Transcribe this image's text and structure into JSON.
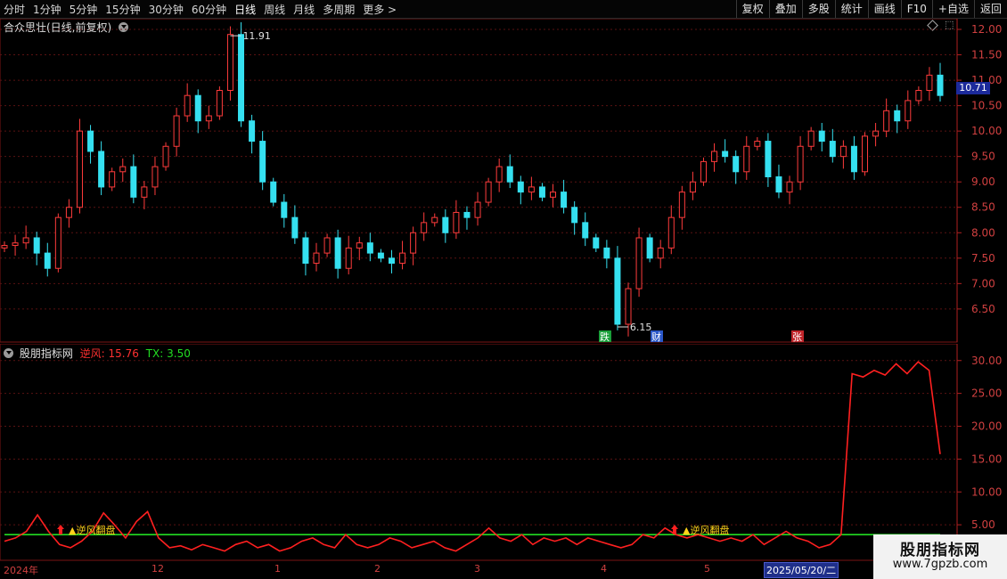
{
  "toolbar": {
    "periods": [
      "分时",
      "1分钟",
      "5分钟",
      "15分钟",
      "30分钟",
      "60分钟",
      "日线",
      "周线",
      "月线",
      "多周期"
    ],
    "active_period": "日线",
    "more_label": "更多",
    "buttons": [
      "复权",
      "叠加",
      "多股",
      "统计",
      "画线",
      "F10",
      "+自选",
      "返回"
    ]
  },
  "main_panel": {
    "title": "合众思壮(日线,前复权)",
    "y_ticks": [
      "12.00",
      "11.50",
      "11.00",
      "10.50",
      "10.00",
      "9.50",
      "9.00",
      "8.50",
      "8.00",
      "7.50",
      "7.00",
      "6.50"
    ],
    "current_price": "10.71",
    "high_label": "11.91",
    "low_label": "6.15",
    "badges": [
      {
        "text": "跌",
        "color": "#1aa03a"
      },
      {
        "text": "财",
        "color": "#2a57c8"
      },
      {
        "text": "张",
        "color": "#c0252a"
      }
    ]
  },
  "indicator_panel": {
    "title": "股朋指标网",
    "series1_label": "逆风: 15.76",
    "series2_label": "TX: 3.50",
    "y_ticks": [
      "30.00",
      "25.00",
      "20.00",
      "15.00",
      "10.00",
      "5.00"
    ],
    "signal_text": "▲逆风翻盘"
  },
  "date_axis": {
    "labels": [
      "2024年",
      "12",
      "1",
      "2",
      "3",
      "4",
      "5"
    ],
    "cursor_date": "2025/05/20/二"
  },
  "watermark": {
    "line1": "股朋指标网",
    "line2": "www.7gpzb.com"
  },
  "colors": {
    "up": "#ff3b3b",
    "down": "#35e0f0",
    "line_nifeng": "#ff2020",
    "line_tx": "#22dd22",
    "grid": "#5a1212"
  },
  "chart_data": [
    {
      "type": "line",
      "title": "合众思壮(日线,前复权)",
      "note_values": {
        "high": 11.91,
        "low": 6.15,
        "last": 10.71
      },
      "ylim": [
        6.2,
        12.0
      ],
      "x_labels": [
        "2024年",
        "12",
        "1",
        "2",
        "3",
        "4",
        "5"
      ],
      "series": [
        {
          "values": [
            7.75,
            7.8,
            7.9,
            7.6,
            7.3,
            8.3,
            8.5,
            10.0,
            9.6,
            8.9,
            9.2,
            9.3,
            8.7,
            8.9,
            9.3,
            9.7,
            10.3,
            10.7,
            10.2,
            10.3,
            10.8,
            11.9,
            10.2,
            9.8,
            9.0,
            8.6,
            8.3,
            7.9,
            7.4,
            7.6,
            7.9,
            7.3,
            7.7,
            7.8,
            7.6,
            7.5,
            7.4,
            7.6,
            8.0,
            8.2,
            8.3,
            8.0,
            8.4,
            8.3,
            8.6,
            9.0,
            9.3,
            9.0,
            8.8,
            8.9,
            8.7,
            8.8,
            8.5,
            8.2,
            7.9,
            7.7,
            7.5,
            6.2,
            6.9,
            7.9,
            7.5,
            7.7,
            8.3,
            8.8,
            9.0,
            9.4,
            9.6,
            9.5,
            9.2,
            9.7,
            9.8,
            9.1,
            8.8,
            9.0,
            9.7,
            10.0,
            9.8,
            9.5,
            9.7,
            9.2,
            9.9,
            10.0,
            10.4,
            10.2,
            10.6,
            10.8,
            11.1,
            10.7
          ]
        }
      ]
    },
    {
      "type": "line",
      "title": "股朋指标网",
      "ylim": [
        0,
        32
      ],
      "series": [
        {
          "name": "逆风",
          "values": [
            2.5,
            3.0,
            4.0,
            6.5,
            4.0,
            2.0,
            1.5,
            2.5,
            4.0,
            6.8,
            5.0,
            3.0,
            5.5,
            7.0,
            3.0,
            1.5,
            1.8,
            1.2,
            2.0,
            1.5,
            1.0,
            2.0,
            2.5,
            1.5,
            2.0,
            1.0,
            1.5,
            2.5,
            3.0,
            2.0,
            1.5,
            3.5,
            2.0,
            1.5,
            2.0,
            3.0,
            2.5,
            1.5,
            2.0,
            2.5,
            1.5,
            1.0,
            2.0,
            3.0,
            4.5,
            3.0,
            2.5,
            3.5,
            2.0,
            3.0,
            2.5,
            3.0,
            2.0,
            3.0,
            2.5,
            2.0,
            1.5,
            2.0,
            3.5,
            3.0,
            4.5,
            3.5,
            3.0,
            3.5,
            3.0,
            2.5,
            3.0,
            2.5,
            3.5,
            2.0,
            3.0,
            4.0,
            3.0,
            2.5,
            1.5,
            2.0,
            3.5,
            28.0,
            27.5,
            28.5,
            27.8,
            29.5,
            28.0,
            29.8,
            28.5,
            15.76
          ]
        },
        {
          "name": "TX",
          "values": [
            3.5,
            3.5,
            3.5,
            3.5,
            3.5,
            3.5,
            3.5,
            3.5,
            3.5,
            3.5,
            3.5,
            3.5,
            3.5,
            3.5,
            3.5,
            3.5,
            3.5,
            3.5,
            3.5,
            3.5,
            3.5,
            3.5,
            3.5,
            3.5,
            3.5,
            3.5,
            3.5,
            3.5,
            3.5,
            3.5,
            3.5,
            3.5,
            3.5,
            3.5,
            3.5,
            3.5,
            3.5,
            3.5,
            3.5,
            3.5,
            3.5,
            3.5,
            3.5,
            3.5,
            3.5,
            3.5,
            3.5,
            3.5,
            3.5,
            3.5,
            3.5,
            3.5,
            3.5,
            3.5,
            3.5,
            3.5,
            3.5,
            3.5,
            3.5,
            3.5,
            3.5,
            3.5,
            3.5,
            3.5,
            3.5,
            3.5,
            3.5,
            3.5,
            3.5,
            3.5,
            3.5,
            3.5,
            3.5,
            3.5,
            3.5,
            3.5,
            3.5,
            3.5,
            3.5,
            3.5,
            3.5,
            3.5,
            3.5,
            3.5,
            3.5,
            3.5
          ]
        }
      ]
    }
  ]
}
